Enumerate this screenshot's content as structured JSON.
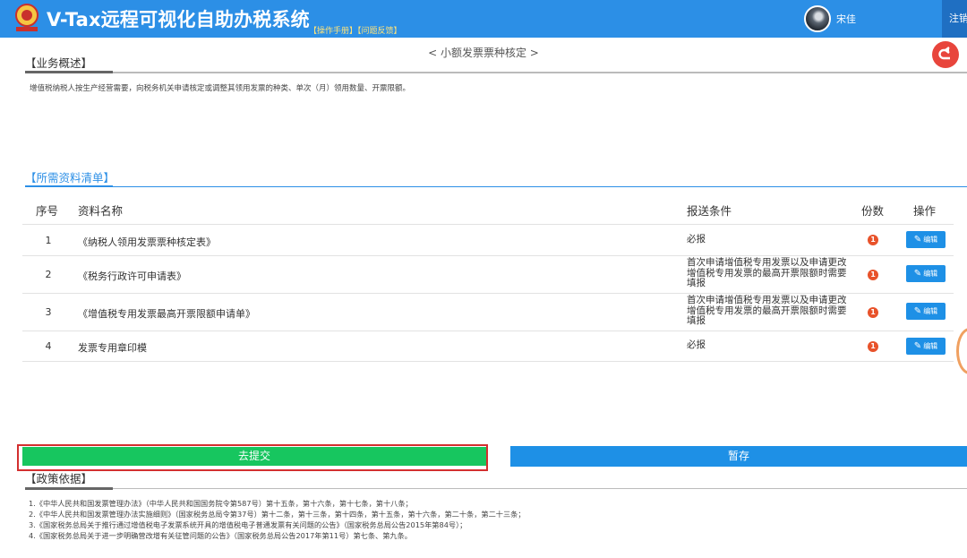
{
  "header": {
    "app_title": "V-Tax远程可视化自助办税系统",
    "manual_link": "【操作手册】",
    "feedback_link": "【问题反馈】",
    "user_name": "宋佳",
    "logout_label": "注销"
  },
  "page": {
    "title": "< 小额发票票种核定 >"
  },
  "overview": {
    "heading": "【业务概述】",
    "text": "增值税纳税人按生产经营需要，向税务机关申请核定或调整其领用发票的种类、单次（月）领用数量、开票限额。"
  },
  "materials": {
    "heading": "【所需资料清单】",
    "columns": {
      "index": "序号",
      "name": "资料名称",
      "condition": "报送条件",
      "count": "份数",
      "action": "操作"
    },
    "rows": [
      {
        "index": "1",
        "name": "《纳税人领用发票票种核定表》",
        "condition": "必报",
        "count": "1",
        "action": "编辑"
      },
      {
        "index": "2",
        "name": "《税务行政许可申请表》",
        "condition": "首次申请增值税专用发票以及申请更改增值税专用发票的最高开票限额时需要填报",
        "count": "1",
        "action": "编辑"
      },
      {
        "index": "3",
        "name": "《增值税专用发票最高开票限额申请单》",
        "condition": "首次申请增值税专用发票以及申请更改增值税专用发票的最高开票限额时需要填报",
        "count": "1",
        "action": "编辑"
      },
      {
        "index": "4",
        "name": "发票专用章印模",
        "condition": "必报",
        "count": "1",
        "action": "编辑"
      }
    ]
  },
  "actions": {
    "submit_label": "去提交",
    "save_label": "暂存"
  },
  "policy": {
    "heading": "【政策依据】",
    "items": [
      "1.《中华人民共和国发票管理办法》（中华人民共和国国务院令第587号）第十五条，第十六条，第十七条，第十八条；",
      "2.《中华人民共和国发票管理办法实施细则》（国家税务总局令第37号）第十二条，第十三条，第十四条，第十五条，第十六条，第二十条，第二十三条；",
      "3.《国家税务总局关于推行通过增值税电子发票系统开具的增值税电子普通发票有关问题的公告》（国家税务总局公告2015年第84号）；",
      "4.《国家税务总局关于进一步明确营改增有关征管问题的公告》（国家税务总局公告2017年第11号）第七条、第九条。"
    ]
  },
  "colors": {
    "header_bg": "#2c8fe6",
    "submit_bg": "#17c65f",
    "save_bg": "#1e90e6",
    "badge": "#e8522a",
    "highlight_frame": "#d32f2f"
  }
}
